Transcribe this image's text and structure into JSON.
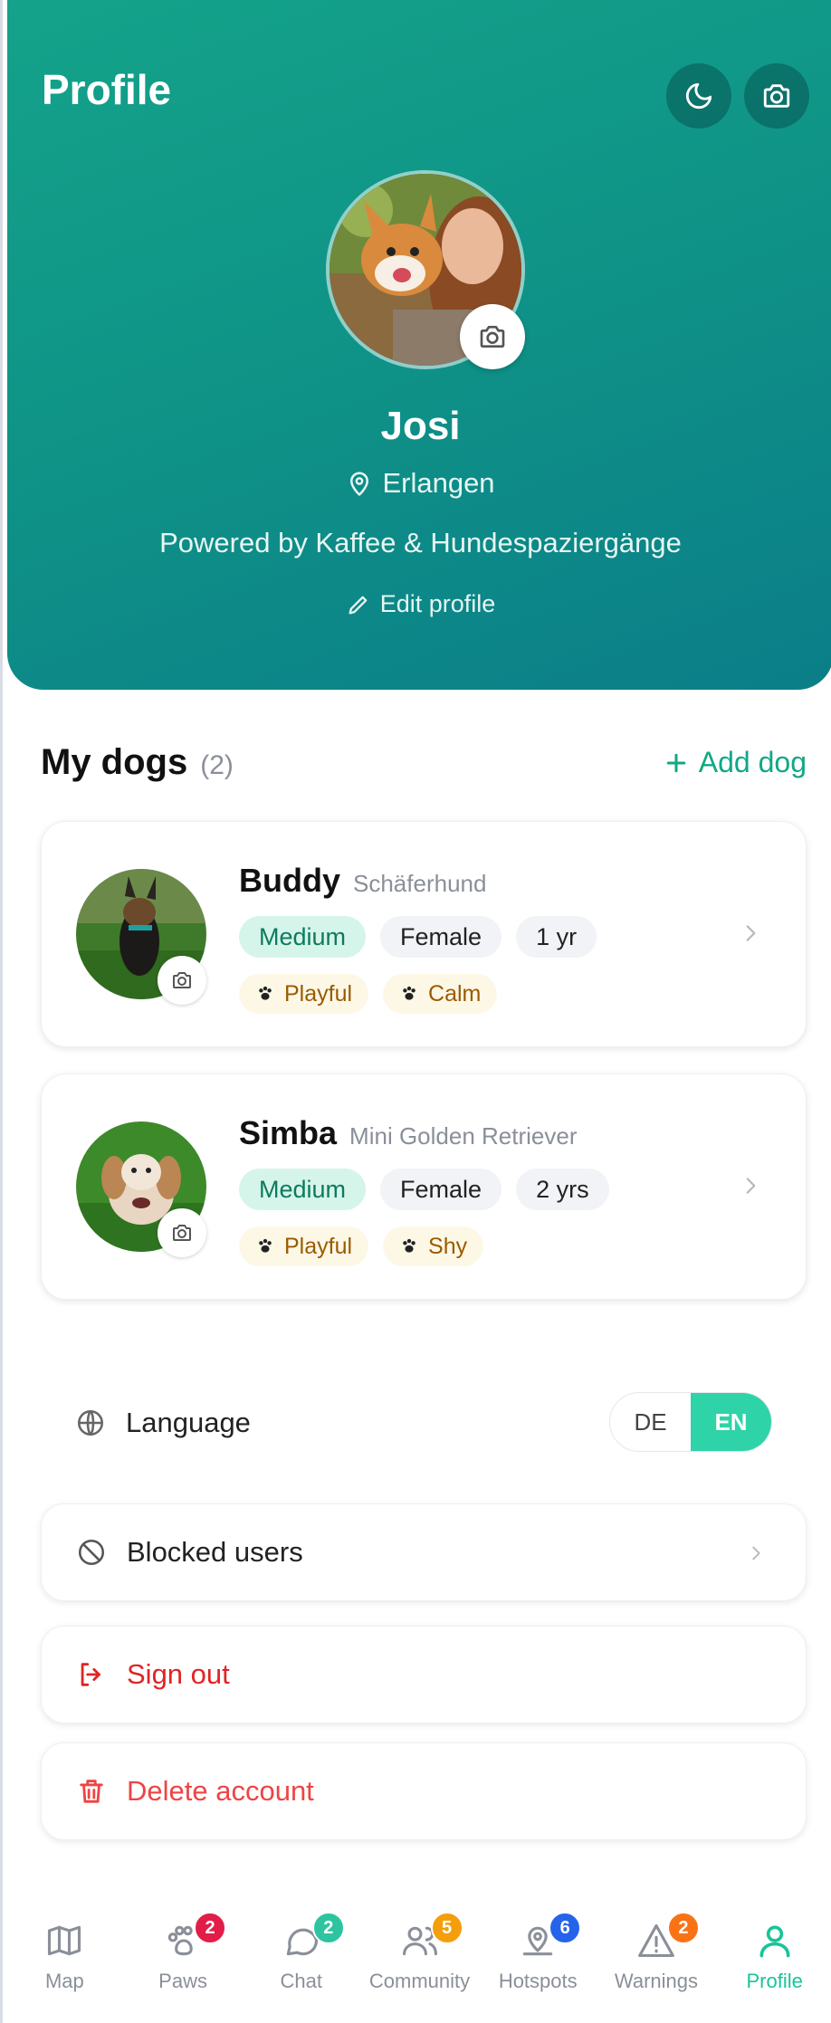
{
  "header": {
    "title": "Profile"
  },
  "user": {
    "name": "Josi",
    "location": "Erlangen",
    "bio": "Powered by Kaffee & Hundespaziergänge",
    "edit_label": "Edit profile"
  },
  "dogs_section": {
    "title": "My dogs",
    "count": "(2)",
    "add_label": "Add dog"
  },
  "dogs": [
    {
      "name": "Buddy",
      "breed": "Schäferhund",
      "size": "Medium",
      "gender": "Female",
      "age": "1 yr",
      "traits": [
        "Playful",
        "Calm"
      ]
    },
    {
      "name": "Simba",
      "breed": "Mini Golden Retriever",
      "size": "Medium",
      "gender": "Female",
      "age": "2 yrs",
      "traits": [
        "Playful",
        "Shy"
      ]
    }
  ],
  "settings": {
    "language_label": "Language",
    "lang_options": [
      "DE",
      "EN"
    ],
    "lang_selected": "EN",
    "blocked_label": "Blocked users",
    "signout_label": "Sign out",
    "delete_label": "Delete account"
  },
  "nav": [
    {
      "label": "Map",
      "icon": "map-icon",
      "badge": ""
    },
    {
      "label": "Paws",
      "icon": "paw-icon",
      "badge": "2",
      "badge_color": "#e11d48"
    },
    {
      "label": "Chat",
      "icon": "chat-icon",
      "badge": "2",
      "badge_color": "#2ec4a0"
    },
    {
      "label": "Community",
      "icon": "users-icon",
      "badge": "5",
      "badge_color": "#f59e0b"
    },
    {
      "label": "Hotspots",
      "icon": "map-pin-icon",
      "badge": "6",
      "badge_color": "#2563eb"
    },
    {
      "label": "Warnings",
      "icon": "warning-icon",
      "badge": "2",
      "badge_color": "#f97316"
    },
    {
      "label": "Profile",
      "icon": "user-icon",
      "badge": ""
    }
  ],
  "colors": {
    "accent": "#19c49a",
    "header_start": "#14a38a",
    "header_end": "#0b7e88",
    "danger": "#e02424"
  }
}
